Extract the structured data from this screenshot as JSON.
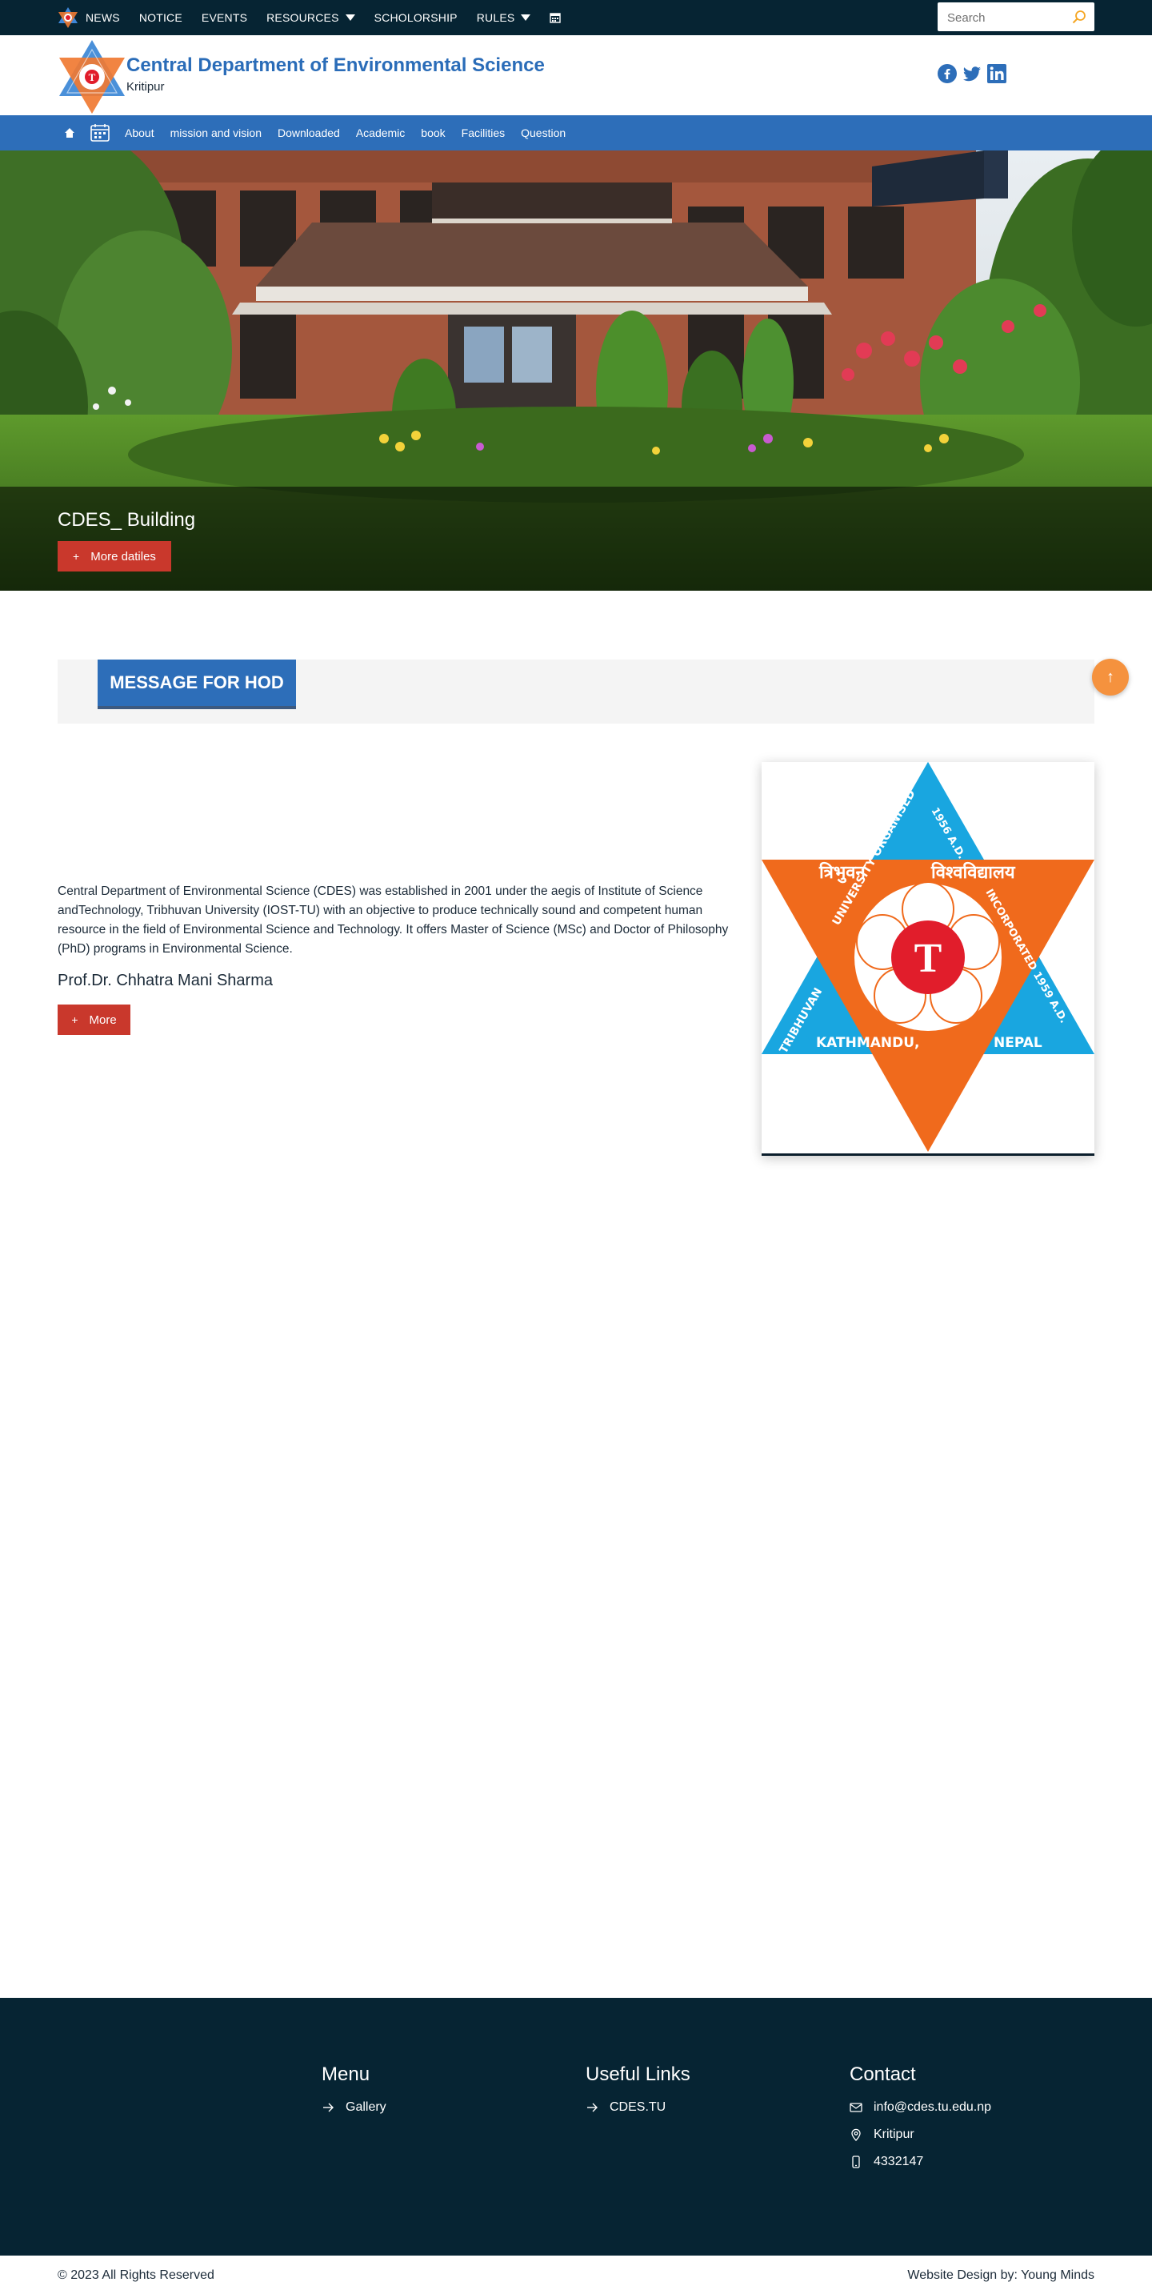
{
  "topbar": {
    "nav": [
      {
        "label": "NEWS",
        "has_caret": false
      },
      {
        "label": "NOTICE",
        "has_caret": false
      },
      {
        "label": "EVENTS",
        "has_caret": false
      },
      {
        "label": "RESOURCES",
        "has_caret": true
      },
      {
        "label": "SCHOLORSHIP",
        "has_caret": false
      },
      {
        "label": "RULES",
        "has_caret": true
      }
    ],
    "calendar_icon": "calendar-icon",
    "search": {
      "placeholder": "Search",
      "value": "",
      "icon": "search-icon"
    }
  },
  "header": {
    "title": "Central Department of Environmental Science",
    "subtitle": "Kritipur",
    "socials": [
      "facebook-icon",
      "twitter-icon",
      "linkedin-icon"
    ]
  },
  "mainnav": {
    "home_icon": "home-icon",
    "calendar_icon": "calendar-icon",
    "links": [
      "About",
      "mission and vision",
      "Downloaded",
      "Academic",
      "book",
      "Facilities",
      "Question"
    ]
  },
  "hero": {
    "caption": "CDES_ Building",
    "button_label": "More datiles"
  },
  "hod": {
    "heading": "MESSAGE FOR HOD",
    "message": "Central Department of Environmental Science (CDES) was established in 2001 under the aegis of Institute of Science andTechnology, Tribhuvan University (IOST-TU) with an objective to produce technically sound and competent human resource in the field of Environmental Science and Technology. It offers Master of Science (MSc) and Doctor of Philosophy (PhD) programs in Environmental Science.",
    "name": "Prof.Dr. Chhatra Mani Sharma",
    "button_label": "More",
    "emblem": {
      "text_tribhuvan_np": "त्रिभुवन",
      "text_vishwavidyalaya": "विश्वविद्यालय",
      "text_organised": "UNIVERSITY ORGANISED",
      "text_1956": "1956 A.D.",
      "text_incorporated": "INCORPORATED 1959 A.D.",
      "text_tribhuvan": "TRIBHUVAN",
      "text_kathmandu": "KATHMANDU,",
      "text_nepal": "NEPAL"
    }
  },
  "footer": {
    "menu": {
      "title": "Menu",
      "items": [
        "Gallery"
      ]
    },
    "links": {
      "title": "Useful Links",
      "items": [
        "CDES.TU"
      ]
    },
    "contact": {
      "title": "Contact",
      "email": "info@cdes.tu.edu.np",
      "address": "Kritipur",
      "phone": "4332147"
    },
    "copyright": "© 2023 All Rights Reserved",
    "credit": "Website Design by: Young Minds"
  },
  "colors": {
    "dark": "#062433",
    "primary": "#2d6eb9",
    "accent_red": "#c9382c",
    "back_to_top": "#f5923e",
    "emblem_blue": "#19a6e0",
    "emblem_orange": "#f06a1c",
    "emblem_red": "#e11d2b"
  }
}
